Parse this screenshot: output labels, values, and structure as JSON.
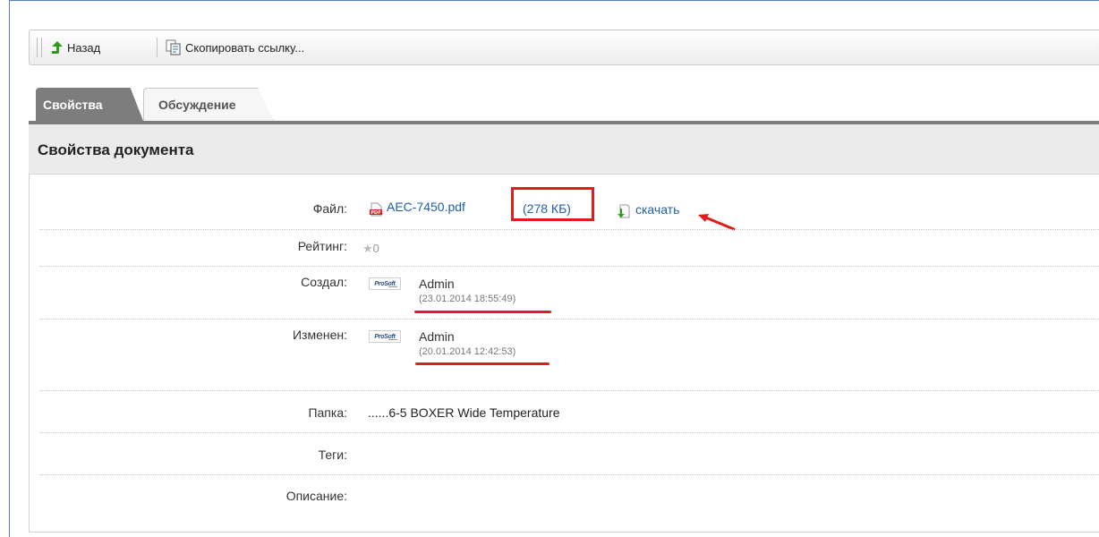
{
  "toolbar": {
    "back_label": "Назад",
    "copy_link_label": "Скопировать ссылку..."
  },
  "tabs": [
    {
      "label": "Свойства",
      "active": true
    },
    {
      "label": "Обсуждение",
      "active": false
    }
  ],
  "section": {
    "title": "Свойства документа"
  },
  "properties": {
    "file": {
      "label": "Файл:",
      "name": "AEC-7450.pdf",
      "size": "(278 КБ)",
      "download_label": "скачать",
      "icon": "pdf-icon"
    },
    "rating": {
      "label": "Рейтинг:",
      "value": "0",
      "icon": "star-icon"
    },
    "created": {
      "label": "Создал:",
      "user": "Admin",
      "date": "(23.01.2014 18:55:49)",
      "avatar_text": "ProSoft"
    },
    "modified": {
      "label": "Изменен:",
      "user": "Admin",
      "date": "(20.01.2014 12:42:53)",
      "avatar_text": "ProSoft"
    },
    "folder": {
      "label": "Папка:",
      "value": "......6-5 BOXER Wide Temperature"
    },
    "tags": {
      "label": "Теги:",
      "value": ""
    },
    "description": {
      "label": "Описание:",
      "value": ""
    }
  },
  "colors": {
    "link": "#1f5fa8",
    "annotation": "#e31b1b",
    "tab_active": "#7d7d7d",
    "back_arrow": "#2e9a1e"
  }
}
